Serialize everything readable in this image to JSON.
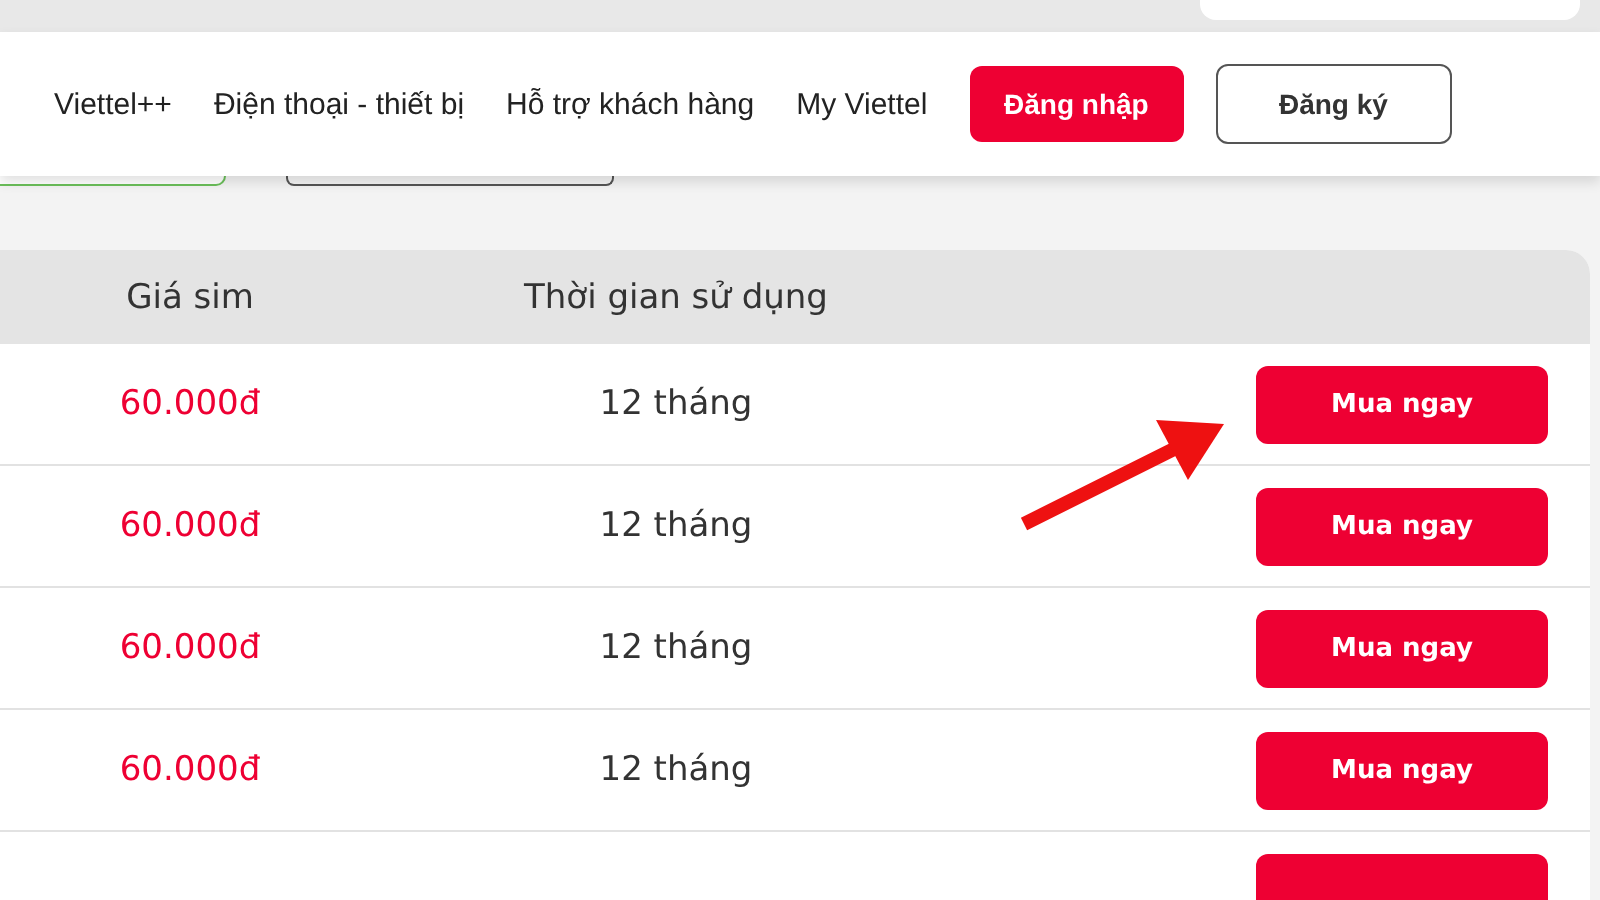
{
  "nav": {
    "items": [
      {
        "label": "Viettel++"
      },
      {
        "label": "Điện thoại - thiết bị"
      },
      {
        "label": "Hỗ trợ khách hàng"
      },
      {
        "label": "My Viettel"
      }
    ],
    "login": "Đăng nhập",
    "register": "Đăng ký"
  },
  "table": {
    "columns": [
      "Giá sim",
      "Thời gian sử dụng"
    ],
    "rows": [
      {
        "price": "60.000đ",
        "duration": "12 tháng",
        "action": "Mua ngay"
      },
      {
        "price": "60.000đ",
        "duration": "12 tháng",
        "action": "Mua ngay"
      },
      {
        "price": "60.000đ",
        "duration": "12 tháng",
        "action": "Mua ngay"
      },
      {
        "price": "60.000đ",
        "duration": "12 tháng",
        "action": "Mua ngay"
      }
    ]
  }
}
